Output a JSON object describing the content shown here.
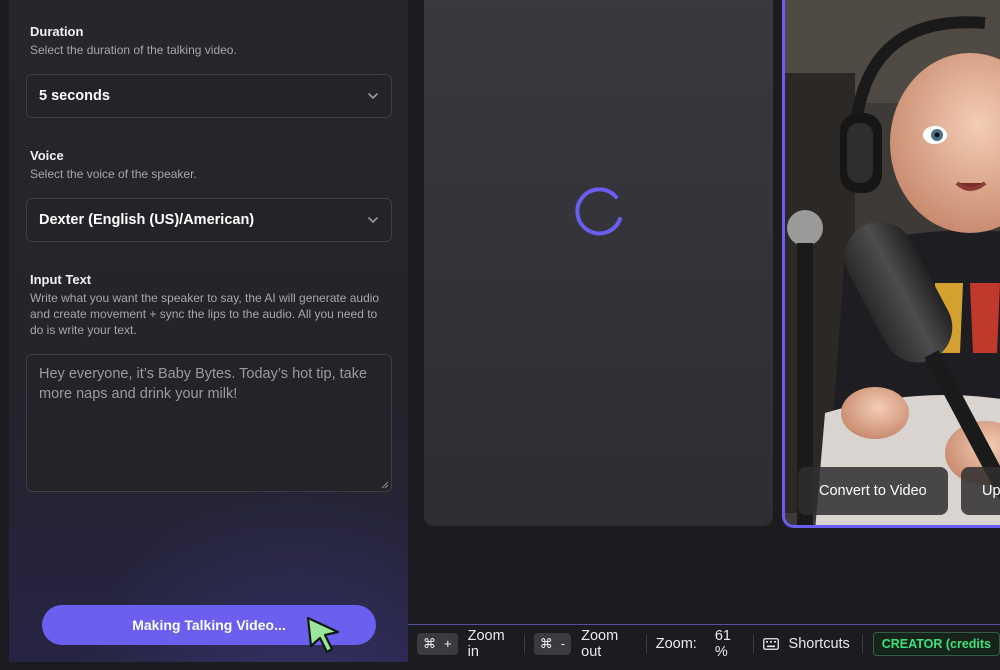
{
  "settings": {
    "duration": {
      "label": "Duration",
      "description": "Select the duration of the talking video.",
      "value": "5 seconds"
    },
    "voice": {
      "label": "Voice",
      "description": "Select the voice of the speaker.",
      "value": "Dexter (English (US)/American)"
    },
    "input_text": {
      "label": "Input Text",
      "description": "Write what you want the speaker to say, the AI will generate audio and create movement + sync the lips to the audio. All you need to do is write your text.",
      "value": "Hey everyone, it’s Baby Bytes. Today’s hot tip, take more naps and drink your milk!"
    },
    "submit_label": "Making Talking Video..."
  },
  "canvas": {
    "actions": {
      "convert": "Convert to Video",
      "upscale": "Up"
    }
  },
  "toolbar": {
    "cmd_symbol": "⌘",
    "zoom_in_key": "+",
    "zoom_in_label": "Zoom in",
    "zoom_out_key": "-",
    "zoom_out_label": "Zoom out",
    "zoom_label": "Zoom:",
    "zoom_value": "61 %",
    "shortcuts_label": "Shortcuts",
    "plan_badge": "CREATOR (credits"
  },
  "colors": {
    "accent": "#6b5ff0",
    "selection_border": "#6a5ef2",
    "plan_badge_text": "#3ee07a"
  }
}
